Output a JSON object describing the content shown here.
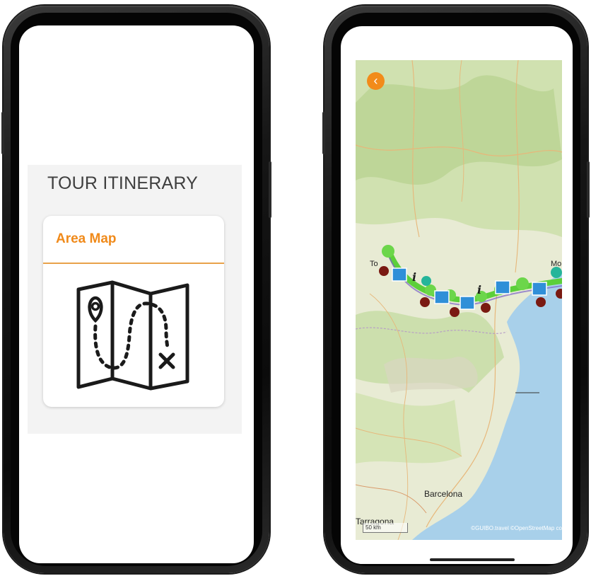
{
  "left_screen": {
    "section_title": "TOUR ITINERARY",
    "card": {
      "title": "Area Map",
      "icon": "folded-map-route-icon",
      "accent_color": "#f08a1a"
    }
  },
  "right_screen": {
    "back_icon": "chevron-left-icon",
    "back_glyph": "‹",
    "labels": {
      "top_left_partial": "To",
      "top_right_partial": "Mo",
      "barcelona": "Barcelona",
      "tarragona": "Tarragona"
    },
    "scale": "50 km",
    "attribution": "©GUIBO.travel ©OpenStreetMap co",
    "colors": {
      "land": "#e7ead3",
      "forest": "#bcd79a",
      "sea": "#a8d0ea",
      "route": "#5ccf3a",
      "bike_marker": "#2f8fd8",
      "lodging_marker": "#7a1a12",
      "back_button": "#f28b1a"
    },
    "markers": [
      "bike-icon",
      "info-icon",
      "shop-cart-icon",
      "lodging-icon"
    ]
  }
}
